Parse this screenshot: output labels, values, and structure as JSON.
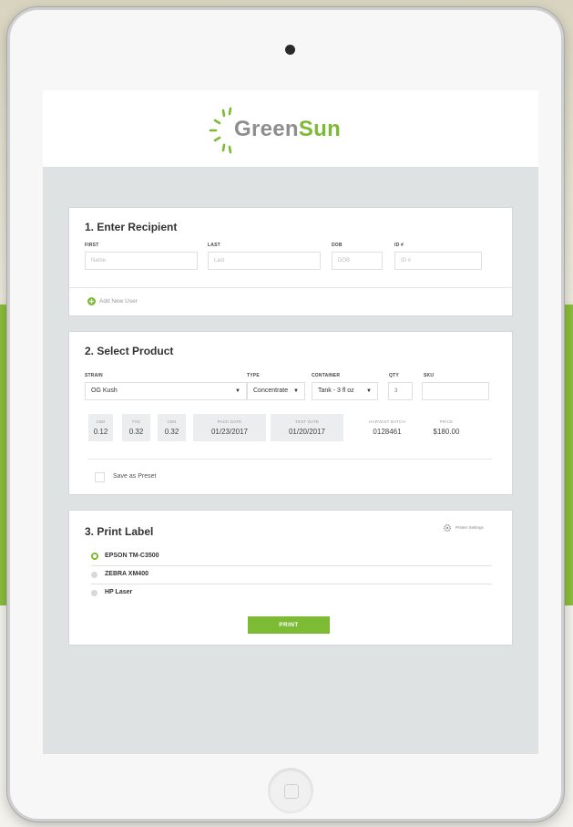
{
  "brand": {
    "name_part1": "Green",
    "name_part2": "Sun",
    "color_green": "#7dbb35",
    "color_gray": "#8e8e8e"
  },
  "recipient": {
    "title": "1. Enter Recipient",
    "fields": [
      {
        "label": "FIRST",
        "placeholder": "Name"
      },
      {
        "label": "LAST",
        "placeholder": "Last"
      },
      {
        "label": "DOB",
        "placeholder": "DOB"
      },
      {
        "label": "ID #",
        "placeholder": "ID #"
      }
    ],
    "add_user_label": "Add New User",
    "add_user_icon": "plus-circle-icon"
  },
  "product": {
    "title": "2. Select Product",
    "strain": {
      "label": "STRAIN",
      "value": "OG Kush"
    },
    "type": {
      "label": "TYPE",
      "value": "Concentrate"
    },
    "container": {
      "label": "CONTAINER",
      "value": "Tank - 3 fl oz"
    },
    "qty": {
      "label": "QTY",
      "value": "3"
    },
    "sku": {
      "label": "SKU",
      "value": ""
    },
    "stats": [
      {
        "label": "CBD",
        "value": "0.12"
      },
      {
        "label": "THC",
        "value": "0.32"
      },
      {
        "label": "CBN",
        "value": "0.32"
      },
      {
        "label": "PACK DATE",
        "value": "01/23/2017"
      },
      {
        "label": "TEST DATE",
        "value": "01/20/2017"
      }
    ],
    "harvest_batch": {
      "label": "HARVEST BATCH",
      "value": "0128461"
    },
    "price": {
      "label": "PRICE",
      "value": "$180.00"
    },
    "preset_label": "Save as Preset"
  },
  "print": {
    "title": "3. Print Label",
    "settings_label": "Printer Settings",
    "settings_icon": "gear-icon",
    "printers": [
      {
        "name": "EPSON TM-C3500",
        "selected": true
      },
      {
        "name": "ZEBRA XM400",
        "selected": false
      },
      {
        "name": "HP Laser",
        "selected": false
      }
    ],
    "button_label": "PRINT"
  }
}
